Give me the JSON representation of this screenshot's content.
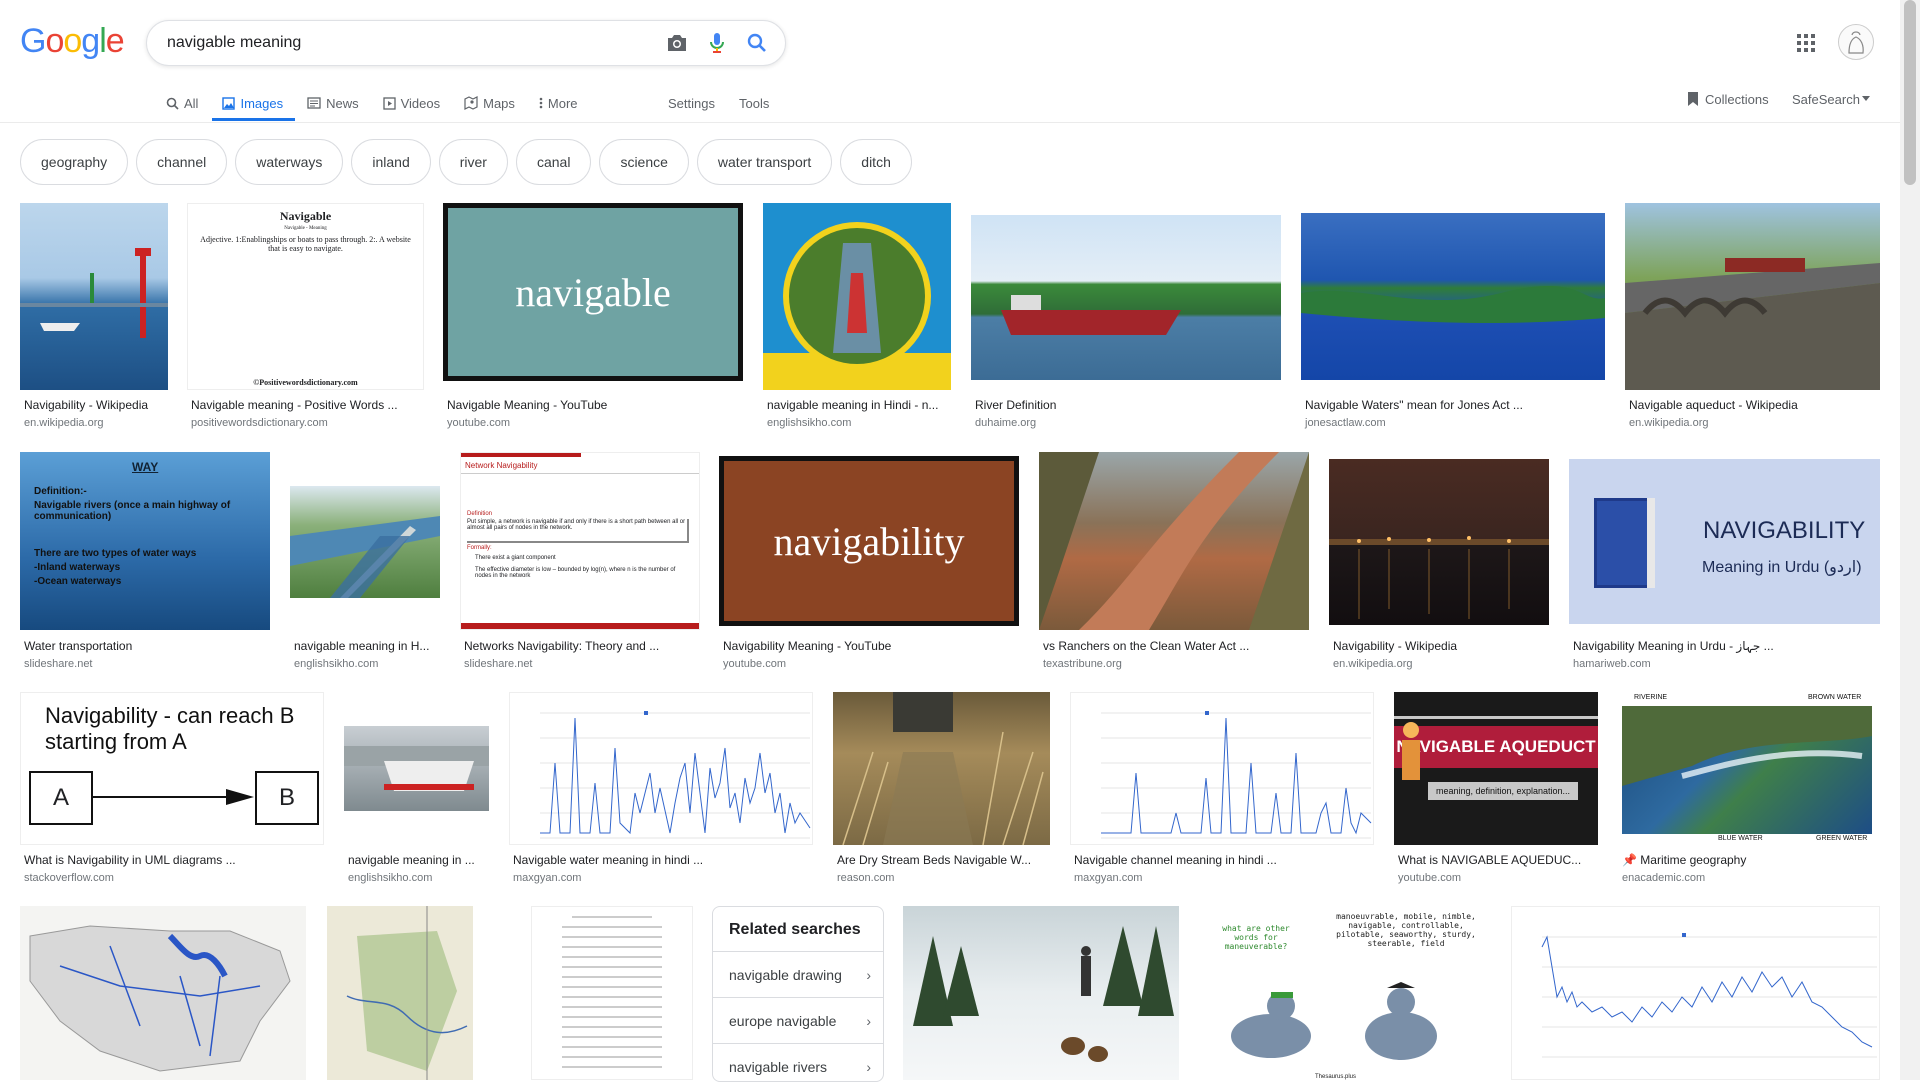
{
  "logo": [
    "G",
    "o",
    "o",
    "g",
    "l",
    "e"
  ],
  "search": {
    "value": "navigable meaning"
  },
  "tabs": [
    {
      "label": "All",
      "icon": "search-icon"
    },
    {
      "label": "Images",
      "icon": "image-icon"
    },
    {
      "label": "News",
      "icon": "news-icon"
    },
    {
      "label": "Videos",
      "icon": "video-icon"
    },
    {
      "label": "Maps",
      "icon": "map-icon"
    },
    {
      "label": "More",
      "icon": "more-vert-icon"
    }
  ],
  "tools": {
    "settings": "Settings",
    "tools": "Tools"
  },
  "right_nav": {
    "collections": "Collections",
    "safesearch": "SafeSearch"
  },
  "chips": [
    "geography",
    "channel",
    "waterways",
    "inland",
    "river",
    "canal",
    "science",
    "water transport",
    "ditch"
  ],
  "results": [
    {
      "title": "Navigability - Wikipedia",
      "source": "en.wikipedia.org"
    },
    {
      "title": "Navigable meaning - Positive Words ...",
      "source": "positivewordsdictionary.com"
    },
    {
      "title": "Navigable Meaning - YouTube",
      "source": "youtube.com"
    },
    {
      "title": "navigable meaning in Hindi - n...",
      "source": "englishsikho.com"
    },
    {
      "title": "River Definition",
      "source": "duhaime.org"
    },
    {
      "title": "Navigable Waters\" mean for Jones Act ...",
      "source": "jonesactlaw.com"
    },
    {
      "title": "Navigable aqueduct - Wikipedia",
      "source": "en.wikipedia.org"
    },
    {
      "title": "Water transportation",
      "source": "slideshare.net"
    },
    {
      "title": "navigable meaning in H...",
      "source": "englishsikho.com"
    },
    {
      "title": "Networks Navigability: Theory and ...",
      "source": "slideshare.net"
    },
    {
      "title": "Navigability Meaning - YouTube",
      "source": "youtube.com"
    },
    {
      "title": "vs Ranchers on the Clean Water Act ...",
      "source": "texastribune.org"
    },
    {
      "title": "Navigability - Wikipedia",
      "source": "en.wikipedia.org"
    },
    {
      "title": "Navigability Meaning in Urdu - جہاز ...",
      "source": "hamariweb.com"
    },
    {
      "title": "What is Navigability in UML diagrams ...",
      "source": "stackoverflow.com"
    },
    {
      "title": "navigable meaning in ...",
      "source": "englishsikho.com"
    },
    {
      "title": "Navigable water meaning in hindi ...",
      "source": "maxgyan.com"
    },
    {
      "title": "Are Dry Stream Beds Navigable W...",
      "source": "reason.com"
    },
    {
      "title": "Navigable channel meaning in hindi ...",
      "source": "maxgyan.com"
    },
    {
      "title": "What is NAVIGABLE AQUEDUC...",
      "source": "youtube.com"
    },
    {
      "title": "Maritime geography",
      "source": "enacademic.com"
    }
  ],
  "thumb_text": {
    "dict_title": "Navigable",
    "dict_sub": "Navigable - Meaning",
    "dict_body": "Adjective. 1:Enablingships or boats to pass through. 2:. A website that is easy to navigate.",
    "dict_footer": "©Positivewordsdictionary.com",
    "yt1": "navigable",
    "yt2": "navigability",
    "water_way": "WAY",
    "water_def": "Definition:-",
    "water_l1": "Navigable rivers (once a main highway of communication)",
    "water_l2": "There are two types of water ways",
    "water_l3": "-Inland waterways",
    "water_l4": "-Ocean waterways",
    "net_title": "Network Navigability",
    "net_def": "Definition",
    "net_body": "Put simple, a network is navigable if and only if there is a short path between all or almost all pairs of nodes in the network.",
    "net_formally": "Formally:",
    "net_b1": "There exist a giant component",
    "net_b2": "The effective diameter is low – bounded by log(n), where n is the number of nodes in the network",
    "urdu_title": "NAVIGABILITY",
    "urdu_sub": "Meaning in Urdu (اردو)",
    "uml_title": "Navigability - can reach B starting from A",
    "uml_a": "A",
    "uml_b": "B",
    "aq_title": "NAVIGABLE AQUEDUCT",
    "aq_sub": "meaning, definition, explanation...",
    "map_riverine": "RIVERINE",
    "map_brown": "BROWN WATER",
    "map_blue": "BLUE WATER",
    "map_green": "GREEN WATER",
    "pigeon_q": "what are other words for maneuverable?",
    "pigeon_a": "manoeuvrable, mobile, nimble, navigable, controllable, pilotable, seaworthy, sturdy, steerable, field",
    "pigeon_src": "Thesaurus.plus"
  },
  "related": {
    "title": "Related searches",
    "items": [
      "navigable drawing",
      "europe navigable",
      "navigable rivers"
    ]
  },
  "colors": {
    "accent": "#1a73e8",
    "chip_border": "#dadce0",
    "source": "#70757a"
  }
}
